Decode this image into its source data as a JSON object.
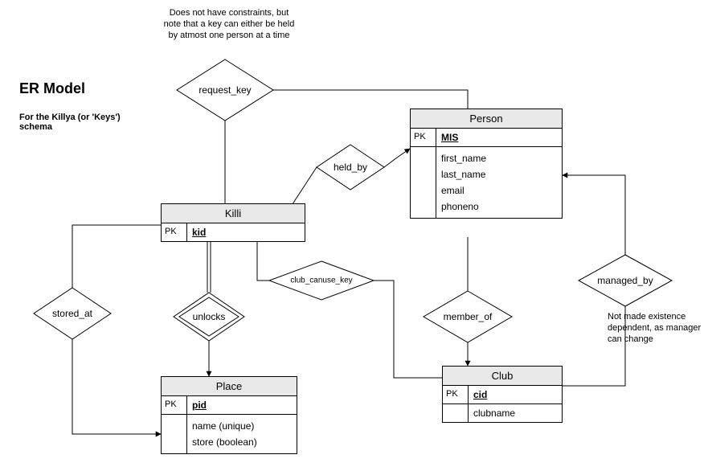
{
  "title": "ER Model",
  "subtitle": "For the Killya (or 'Keys') schema",
  "notes": {
    "request_key": "Does not have constraints, but note that a key can either be held by atmost one person at a time",
    "managed_by": "Not made existence dependent, as manager can change"
  },
  "entities": {
    "person": {
      "name": "Person",
      "pk_label": "PK",
      "pk_attr": "MIS",
      "attrs": [
        "first_name",
        "last_name",
        "email",
        "phoneno"
      ]
    },
    "killi": {
      "name": "Killi",
      "pk_label": "PK",
      "pk_attr": "kid"
    },
    "place": {
      "name": "Place",
      "pk_label": "PK",
      "pk_attr": "pid",
      "attrs": [
        "name (unique)",
        "store (boolean)"
      ]
    },
    "club": {
      "name": "Club",
      "pk_label": "PK",
      "pk_attr": "cid",
      "attrs": [
        "clubname"
      ]
    }
  },
  "relationships": {
    "request_key": "request_key",
    "held_by": "held_by",
    "stored_at": "stored_at",
    "unlocks": "unlocks",
    "club_canuse_key": "club_canuse_key",
    "member_of": "member_of",
    "managed_by": "managed_by"
  }
}
